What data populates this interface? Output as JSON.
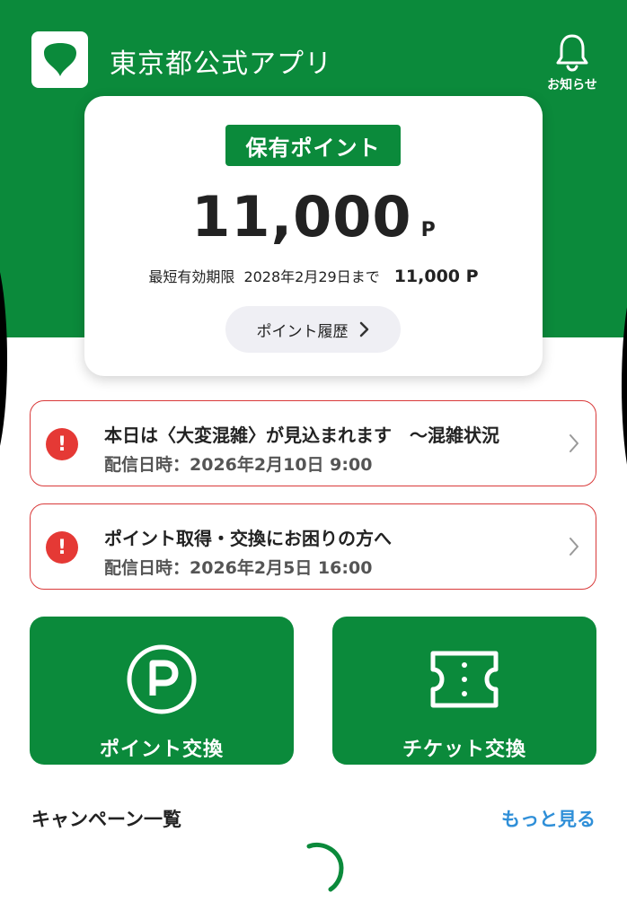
{
  "header": {
    "app_title": "東京都公式アプリ",
    "notice_label": "お知らせ",
    "logo_icon": "ginkgo-leaf-icon",
    "notice_icon": "bell-icon"
  },
  "points_card": {
    "badge": "保有ポイント",
    "total": "11,000",
    "unit": "P",
    "expiry_label": "最短有効期限",
    "expiry_date": "2028年2月29日まで",
    "expiry_points": "11,000 P",
    "history_button": "ポイント履歴"
  },
  "alerts": [
    {
      "title": "本日は〈大変混雑〉が見込まれます　～混雑状況",
      "date": "配信日時：2026年2月10日 9:00"
    },
    {
      "title": "ポイント取得・交換にお困りの方へ",
      "date": "配信日時：2026年2月5日 16:00"
    }
  ],
  "actions": {
    "points_exchange": {
      "label": "ポイント交換",
      "icon": "p-circle-icon"
    },
    "ticket_exchange": {
      "label": "チケット交換",
      "icon": "ticket-icon"
    }
  },
  "campaigns": {
    "title": "キャンペーン一覧",
    "more_link": "もっと見る"
  },
  "colors": {
    "brand_green": "#0b8a3b",
    "alert_red": "#e53935",
    "link_blue": "#2f8fd8"
  }
}
